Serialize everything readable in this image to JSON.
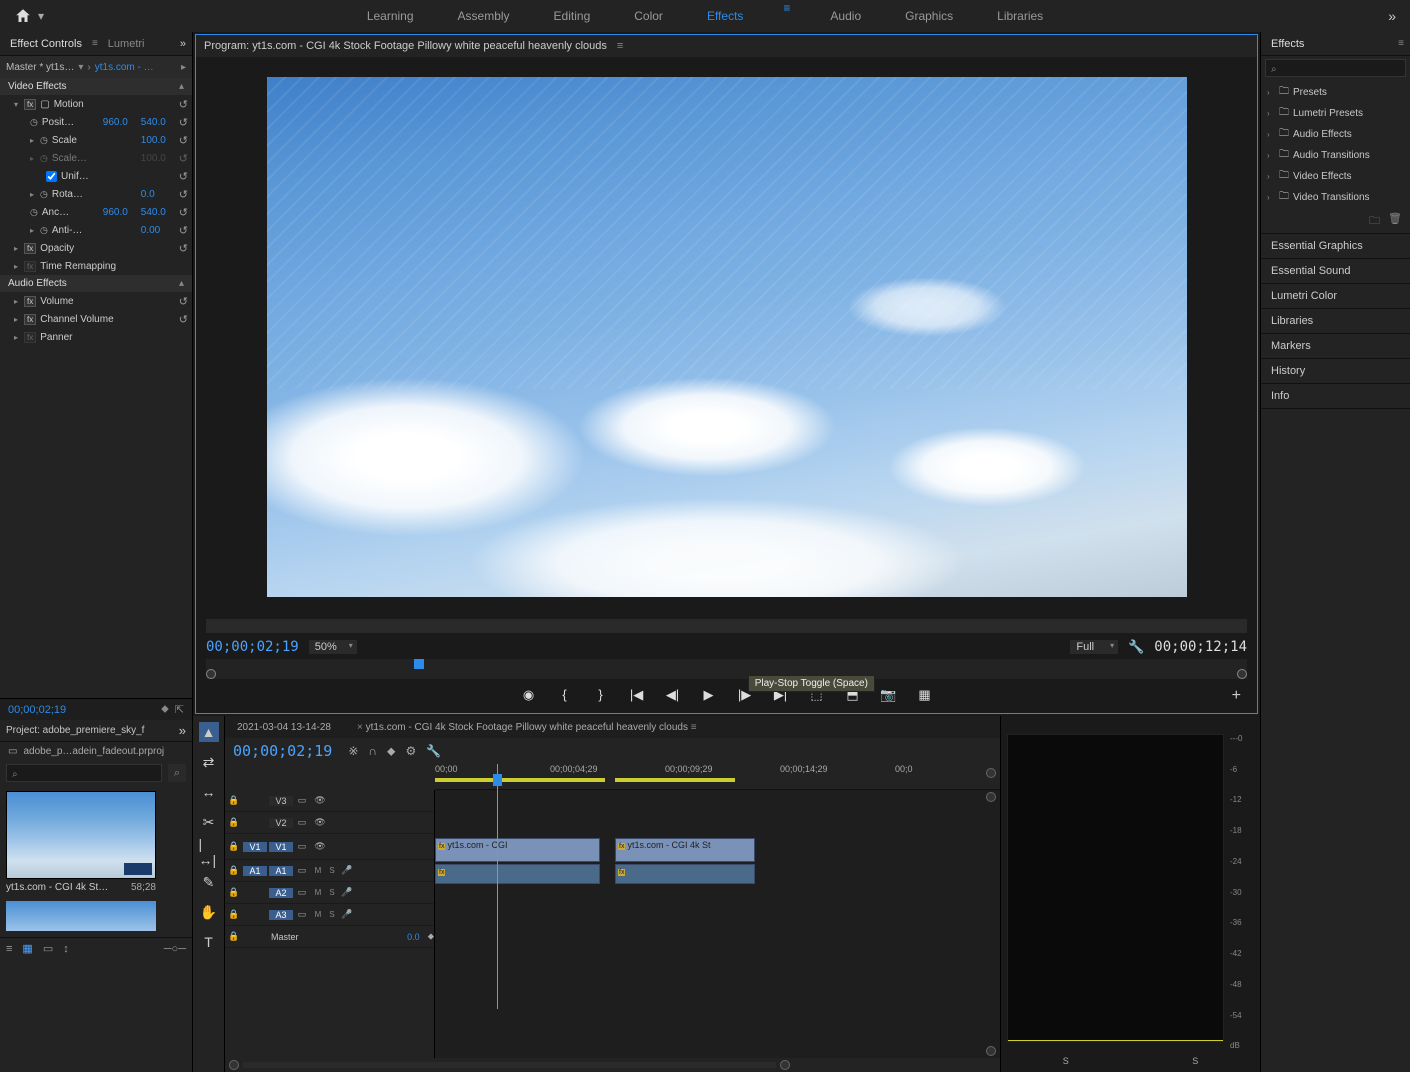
{
  "workspaces": [
    "Learning",
    "Assembly",
    "Editing",
    "Color",
    "Effects",
    "Audio",
    "Graphics",
    "Libraries"
  ],
  "active_workspace": "Effects",
  "effect_controls": {
    "tab": "Effect Controls",
    "tab2": "Lumetri",
    "master": "Master * yt1s…",
    "sequence": "yt1s.com - …",
    "video_effects_label": "Video Effects",
    "motion": {
      "label": "Motion",
      "position_label": "Posit…",
      "position_x": "960.0",
      "position_y": "540.0",
      "scale_label": "Scale",
      "scale": "100.0",
      "scale_w_label": "Scale…",
      "scale_w": "100.0",
      "uniform_label": "Unif…",
      "rotation_label": "Rota…",
      "rotation": "0.0",
      "anchor_label": "Anc…",
      "anchor_x": "960.0",
      "anchor_y": "540.0",
      "antiflicker_label": "Anti-…",
      "antiflicker": "0.00"
    },
    "opacity_label": "Opacity",
    "time_remap_label": "Time Remapping",
    "audio_effects_label": "Audio Effects",
    "volume_label": "Volume",
    "channel_volume_label": "Channel Volume",
    "panner_label": "Panner"
  },
  "timecode_left": "00;00;02;19",
  "project": {
    "tab": "Project: adobe_premiere_sky_f",
    "file": "adobe_p…adein_fadeout.prproj",
    "search_placeholder": "",
    "items": [
      {
        "name": "yt1s.com -  CGI 4k St…",
        "duration": "58;28"
      }
    ]
  },
  "program": {
    "title": "Program: yt1s.com -  CGI 4k Stock Footage  Pillowy white peaceful heavenly clouds",
    "timecode": "00;00;02;19",
    "zoom": "50%",
    "resolution": "Full",
    "duration": "00;00;12;14",
    "tooltip": "Play-Stop Toggle (Space)"
  },
  "timeline": {
    "tabs": [
      {
        "label": "2021-03-04 13-14-28"
      },
      {
        "label": "yt1s.com -  CGI 4k Stock Footage  Pillowy white peaceful heavenly clouds"
      }
    ],
    "timecode": "00;00;02;19",
    "ruler": [
      "00;00",
      "00;00;04;29",
      "00;00;09;29",
      "00;00;14;29",
      "00;0"
    ],
    "tracks": {
      "v3": "V3",
      "v2": "V2",
      "v1": "V1",
      "a1": "A1",
      "a2": "A2",
      "a3": "A3",
      "master": "Master",
      "master_val": "0.0"
    },
    "clip1": "yt1s.com -  CGI",
    "clip2": "yt1s.com -  CGI 4k St"
  },
  "effects_panel": {
    "tab": "Effects",
    "search_placeholder": "",
    "folders": [
      "Presets",
      "Lumetri Presets",
      "Audio Effects",
      "Audio Transitions",
      "Video Effects",
      "Video Transitions"
    ]
  },
  "side_panels": [
    "Essential Graphics",
    "Essential Sound",
    "Lumetri Color",
    "Libraries",
    "Markers",
    "History",
    "Info"
  ],
  "meter": {
    "scale": [
      "---0",
      "-6",
      "-12",
      "-18",
      "-24",
      "-30",
      "-36",
      "-42",
      "-48",
      "-54",
      "dB"
    ],
    "labels": [
      "S",
      "S"
    ]
  }
}
